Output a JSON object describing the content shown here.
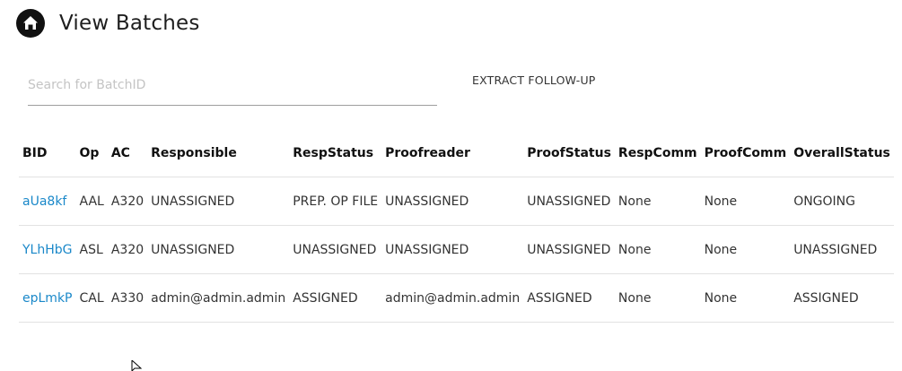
{
  "header": {
    "title": "View Batches",
    "home_icon": "home-icon"
  },
  "search": {
    "placeholder": "Search for BatchID",
    "value": ""
  },
  "toolbar": {
    "extract_label": "EXTRACT FOLLOW-UP"
  },
  "table": {
    "headers": [
      "BID",
      "Op",
      "AC",
      "Responsible",
      "RespStatus",
      "Proofreader",
      "ProofStatus",
      "RespComm",
      "ProofComm",
      "OverallStatus"
    ],
    "rows": [
      [
        "aUa8kf",
        "AAL",
        "A320",
        "UNASSIGNED",
        "PREP. OP FILE",
        "UNASSIGNED",
        "UNASSIGNED",
        "None",
        "None",
        "ONGOING"
      ],
      [
        "YLhHbG",
        "ASL",
        "A320",
        "UNASSIGNED",
        "UNASSIGNED",
        "UNASSIGNED",
        "UNASSIGNED",
        "None",
        "None",
        "UNASSIGNED"
      ],
      [
        "epLmkP",
        "CAL",
        "A330",
        "admin@admin.admin",
        "ASSIGNED",
        "admin@admin.admin",
        "ASSIGNED",
        "None",
        "None",
        "ASSIGNED"
      ]
    ]
  },
  "colors": {
    "link": "#1a88c9",
    "divider": "#e2e2e2"
  }
}
